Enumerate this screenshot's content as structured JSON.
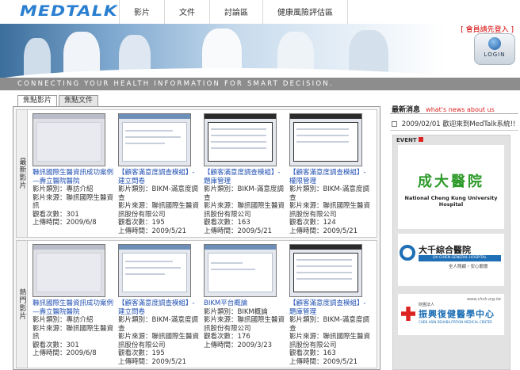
{
  "header": {
    "logo": "MEDTALK",
    "nav": [
      "影片",
      "文件",
      "討論區",
      "健康風險評估區"
    ],
    "login_hint": "[ 會員請先登入 ]",
    "login_button": "LOGIN",
    "tagline": "CONNECTING YOUR HEALTH INFORMATION FOR SMART DECISION."
  },
  "tabs": [
    {
      "label": "焦點影片",
      "active": true
    },
    {
      "label": "焦點文件",
      "active": false
    }
  ],
  "sections": [
    {
      "label": "最新影片",
      "cards": [
        {
          "title": "聯訊國際生醫資訊成功案例—壽立醫院醫院",
          "lines": [
            "影片類別：專訪介紹",
            "影片來源：聯訊國際生醫資訊",
            "觀看次數：301",
            "上傳時間：2009/6/8"
          ]
        },
        {
          "title": "【顧客滿意度調查模組】-建立問卷",
          "lines": [
            "影片類別：BIKM-滿意度調查",
            "影片來源：聯訊國際生醫資訊股份有限公司",
            "觀看次數：195",
            "上傳時間：2009/5/21"
          ]
        },
        {
          "title": "【顧客滿意度調查模組】-題庫管理",
          "lines": [
            "影片類別：BIKM-滿意度調查",
            "影片來源：聯訊國際生醫資訊股份有限公司",
            "觀看次數：163",
            "上傳時間：2009/5/21"
          ]
        },
        {
          "title": "【顧客滿意度調查模組】-權限管理",
          "lines": [
            "影片類別：BIKM-滿意度調查",
            "影片來源：聯訊國際生醫資訊股份有限公司",
            "觀看次數：124",
            "上傳時間：2009/5/21"
          ]
        }
      ]
    },
    {
      "label": "熱門影片",
      "cards": [
        {
          "title": "聯訊國際生醫資訊成功案例—壽立醫院醫院",
          "lines": [
            "影片類別：專訪介紹",
            "影片來源：聯訊國際生醫資訊",
            "觀看次數：301",
            "上傳時間：2009/6/8"
          ]
        },
        {
          "title": "【顧客滿意度調查模組】-建立問卷",
          "lines": [
            "影片類別：BIKM-滿意度調查",
            "影片來源：聯訊國際生醫資訊股份有限公司",
            "觀看次數：195",
            "上傳時間：2009/5/21"
          ]
        },
        {
          "title": "BIKM平台概論",
          "lines": [
            "影片類別：BIKM概論",
            "影片來源：聯訊國際生醫資訊股份有限公司",
            "觀看次數：176",
            "上傳時間：2009/3/23"
          ]
        },
        {
          "title": "【顧客滿意度調查模組】-題庫管理",
          "lines": [
            "影片類別：BIKM-滿意度調查",
            "影片來源：聯訊國際生醫資訊股份有限公司",
            "觀看次數：163",
            "上傳時間：2009/5/21"
          ]
        }
      ]
    }
  ],
  "sidebar": {
    "news_title": "最新消息",
    "news_title_en": "what's news about us",
    "news_item": "2009/02/01 歡迎來到MedTalk系統!!",
    "event_label": "EVENT",
    "ncku": {
      "cn": "成大醫院",
      "en": "National Cheng Kung University Hospital"
    },
    "dachien": {
      "cn": "大千綜合醫院",
      "en": "DA CHIEN GENERAL HOSPITAL",
      "slogan": "全人照顧・安心關懷"
    },
    "rehab": {
      "url": "www.chcb.org.tw",
      "org": "財團法人",
      "cn": "振興復健醫學中心",
      "en": "CHEN HSIN REHABILITATION MEDICAL CENTER"
    }
  }
}
